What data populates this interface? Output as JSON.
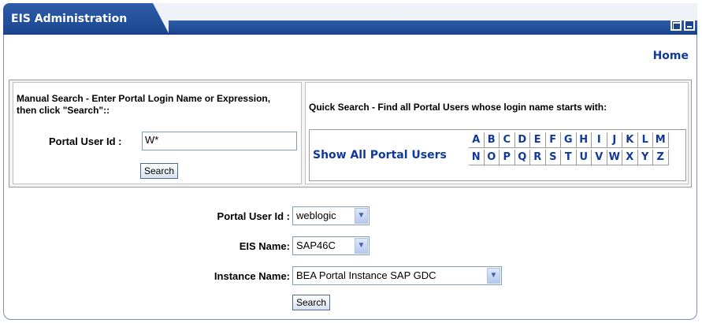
{
  "portlet": {
    "title": "EIS Administration",
    "maximize_icon": "maximize-icon",
    "minimize_icon": "minimize-icon",
    "home_link": "Home"
  },
  "manual_search": {
    "instructions": "Manual Search - Enter Portal Login Name or Expression, then click \"Search\"::",
    "label": "Portal User Id :",
    "value": "W*",
    "button": "Search"
  },
  "quick_search": {
    "instructions": "Quick Search - Find all Portal Users whose login name starts with:",
    "show_all": "Show All Portal Users",
    "letters": [
      "A",
      "B",
      "C",
      "D",
      "E",
      "F",
      "G",
      "H",
      "I",
      "J",
      "K",
      "L",
      "M",
      "N",
      "O",
      "P",
      "Q",
      "R",
      "S",
      "T",
      "U",
      "V",
      "W",
      "X",
      "Y",
      "Z"
    ]
  },
  "form": {
    "user_label": "Portal User Id :",
    "user_value": "weblogic",
    "eis_label": "EIS Name:",
    "eis_value": "SAP46C",
    "instance_label": "Instance Name:",
    "instance_value": "BEA Portal Instance SAP GDC",
    "button": "Search"
  },
  "colors": {
    "title_bar": "#1d4690",
    "link": "#0f3a9c",
    "border": "#7a8fb4"
  }
}
